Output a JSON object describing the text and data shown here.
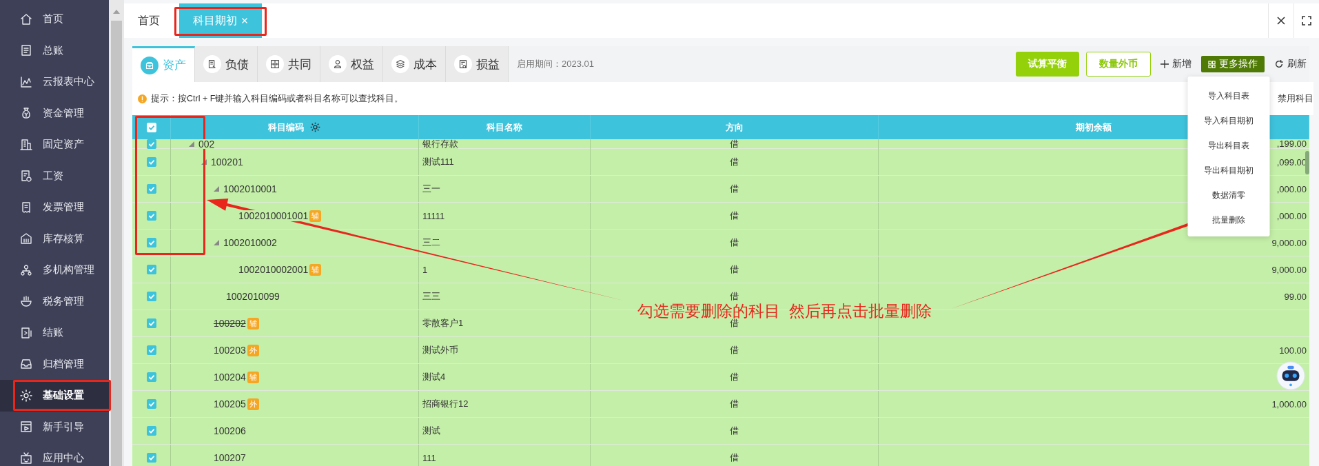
{
  "sidebar": {
    "items": [
      {
        "label": "首页",
        "selected": false
      },
      {
        "label": "总账",
        "selected": false
      },
      {
        "label": "云报表中心",
        "selected": false
      },
      {
        "label": "资金管理",
        "selected": false
      },
      {
        "label": "固定资产",
        "selected": false
      },
      {
        "label": "工资",
        "selected": false
      },
      {
        "label": "发票管理",
        "selected": false
      },
      {
        "label": "库存核算",
        "selected": false
      },
      {
        "label": "多机构管理",
        "selected": false
      },
      {
        "label": "税务管理",
        "selected": false
      },
      {
        "label": "结账",
        "selected": false
      },
      {
        "label": "归档管理",
        "selected": false
      },
      {
        "label": "基础设置",
        "selected": true
      },
      {
        "label": "新手引导",
        "selected": false
      },
      {
        "label": "应用中心",
        "selected": false
      }
    ]
  },
  "tabs": [
    {
      "label": "首页",
      "selected": false,
      "closable": false
    },
    {
      "label": "科目期初",
      "selected": true,
      "closable": true
    }
  ],
  "categories": [
    {
      "label": "资产",
      "selected": true
    },
    {
      "label": "负债",
      "selected": false
    },
    {
      "label": "共同",
      "selected": false
    },
    {
      "label": "权益",
      "selected": false
    },
    {
      "label": "成本",
      "selected": false
    },
    {
      "label": "损益",
      "selected": false
    }
  ],
  "start_period": "启用期间：2023.01",
  "toolbar": {
    "buttons": [
      {
        "label": "试算平衡",
        "kind": "primary"
      },
      {
        "label": "数量外币",
        "kind": "outline"
      },
      {
        "label": "新增",
        "kind": "add"
      },
      {
        "label": "更多操作",
        "kind": "menu",
        "expanded": true
      },
      {
        "label": "刷新",
        "kind": "refresh"
      }
    ]
  },
  "menu": {
    "items": [
      "导入科目表",
      "导入科目期初",
      "导出科目表",
      "导出科目期初",
      "数据清零",
      "批量删除"
    ]
  },
  "hint": "提示：按Ctrl + F键并输入科目编码或者科目名称可以查找科目。",
  "disabled_toggle": "禁用科目",
  "table": {
    "all_checked": true,
    "columns": [
      "科目编码",
      "科目名称",
      "方向",
      "期初余额"
    ],
    "rows": [
      {
        "code": "002",
        "name": "银行存款",
        "direction": "借",
        "balance": ",199.00",
        "checked": true,
        "disabled": false,
        "expanded": true,
        "children": [
          {
            "code": "100201",
            "name": "测试111",
            "direction": "借",
            "balance": ",099.00",
            "checked": true,
            "disabled": false,
            "expanded": true,
            "children": [
              {
                "code": "1002010001",
                "name": "三一",
                "direction": "借",
                "balance": ",000.00",
                "checked": true,
                "disabled": false,
                "expanded": true,
                "children": [
                  {
                    "code": "1002010001001",
                    "tag": "辅",
                    "name": "11111",
                    "direction": "借",
                    "balance": ",000.00",
                    "checked": true,
                    "disabled": false
                  }
                ]
              },
              {
                "code": "1002010002",
                "name": "三二",
                "direction": "借",
                "balance": "9,000.00",
                "checked": true,
                "disabled": false,
                "expanded": true,
                "children": [
                  {
                    "code": "1002010002001",
                    "tag": "辅",
                    "name": "1",
                    "direction": "借",
                    "balance": "9,000.00",
                    "checked": true,
                    "disabled": false
                  }
                ]
              },
              {
                "code": "1002010099",
                "name": "三三",
                "direction": "借",
                "balance": "99.00",
                "checked": true,
                "disabled": false
              }
            ]
          },
          {
            "code": "100202",
            "tag": "辅",
            "name": "零散客户1",
            "direction": "借",
            "checked": true,
            "disabled": true
          },
          {
            "code": "100203",
            "tag": "外",
            "name": "测试外币",
            "direction": "借",
            "balance": "100.00",
            "checked": true,
            "disabled": false
          },
          {
            "code": "100204",
            "tag": "辅",
            "name": "测试4",
            "direction": "借",
            "checked": true,
            "disabled": false
          },
          {
            "code": "100205",
            "tag": "外",
            "name": "招商银行12",
            "direction": "借",
            "balance": "1,000.00",
            "checked": true,
            "disabled": false
          },
          {
            "code": "100206",
            "name": "测试",
            "direction": "借",
            "checked": true,
            "disabled": false
          },
          {
            "code": "100207",
            "name": "111",
            "direction": "借",
            "checked": true,
            "disabled": false
          }
        ]
      }
    ]
  },
  "annotation": {
    "text": "勾选需要删除的科目  然后再点击批量删除"
  }
}
